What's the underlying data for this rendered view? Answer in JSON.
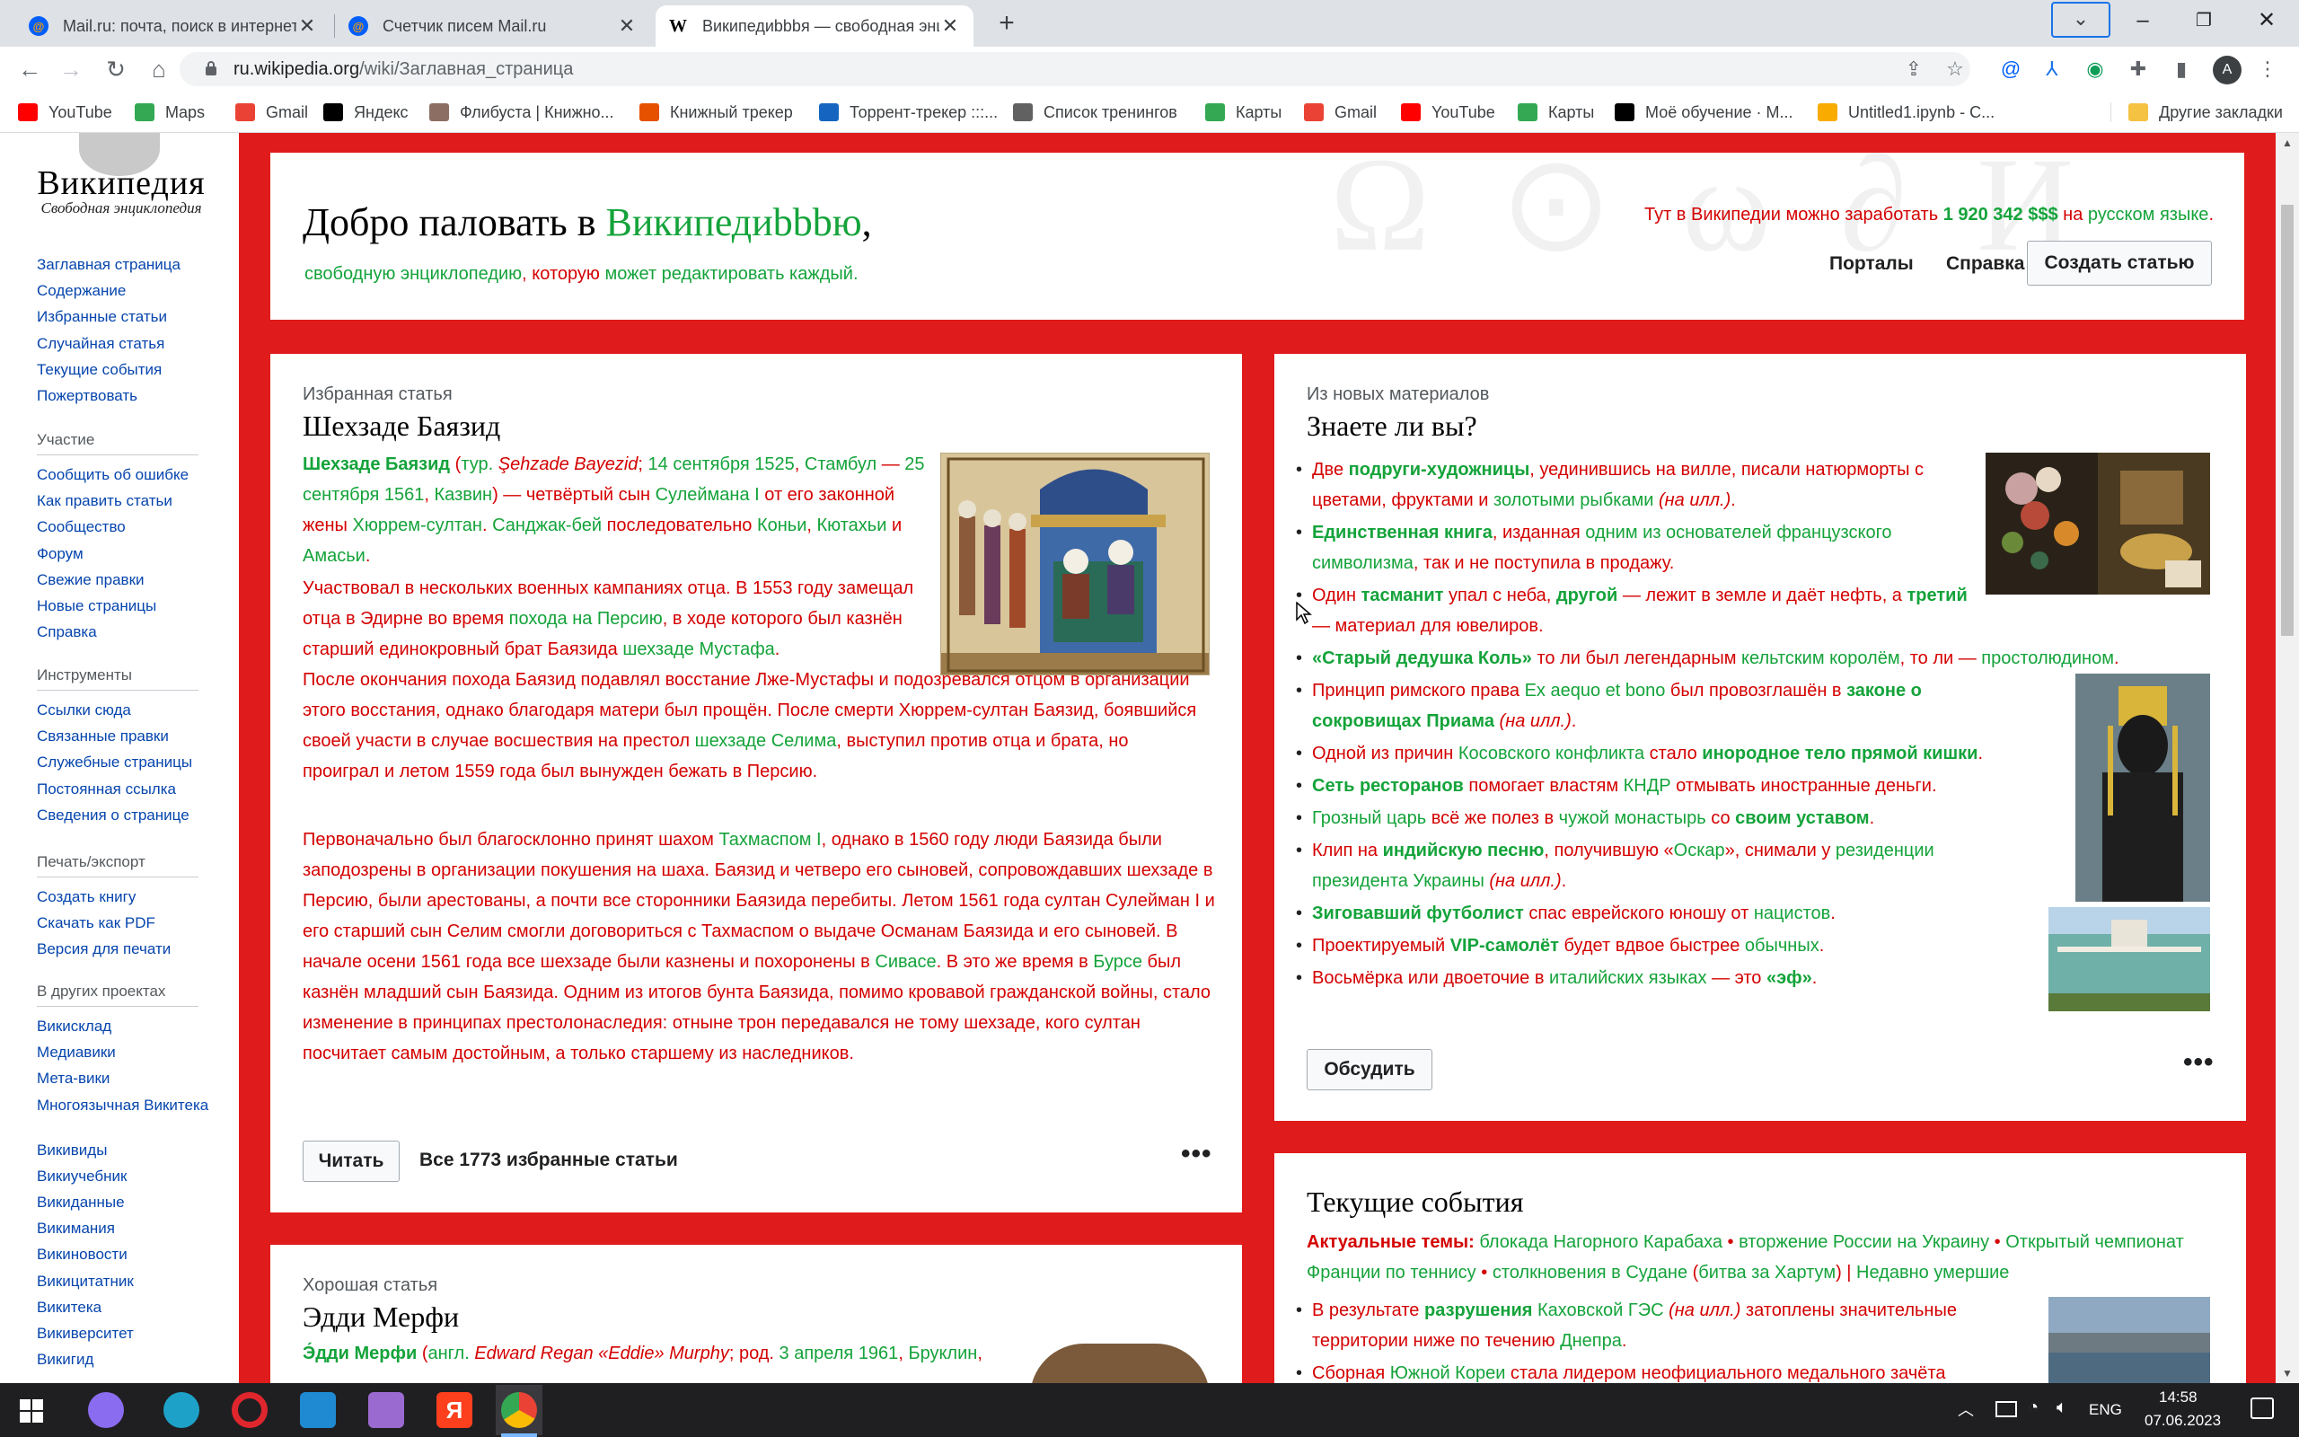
{
  "browser": {
    "tabs": [
      {
        "title": "Mail.ru: почта, поиск в интернете",
        "icon": "mailru-icon"
      },
      {
        "title": "Счетчик писем Mail.ru",
        "icon": "mailru-icon"
      },
      {
        "title": "Википедиbbbя — свободная энциклопедия",
        "icon": "wikipedia-icon"
      }
    ],
    "url_host": "ru.wikipedia.org",
    "url_path": "/wiki/Заглавная_страница",
    "profile_initial": "A",
    "bookmarks": [
      {
        "label": "YouTube",
        "color": "#ff0000"
      },
      {
        "label": "Maps",
        "color": "#34a853"
      },
      {
        "label": "Gmail",
        "color": "#ea4335"
      },
      {
        "label": "Яндекс",
        "color": "#000000"
      },
      {
        "label": "Флибуста | Книжно...",
        "color": "#8d6e63"
      },
      {
        "label": "Книжный трекер",
        "color": "#e65100"
      },
      {
        "label": "Торрент-трекер :::...",
        "color": "#1565c0"
      },
      {
        "label": "Список тренингов",
        "color": "#616161"
      },
      {
        "label": "Карты",
        "color": "#34a853"
      },
      {
        "label": "Gmail",
        "color": "#ea4335"
      },
      {
        "label": "YouTube",
        "color": "#ff0000"
      },
      {
        "label": "Карты",
        "color": "#34a853"
      },
      {
        "label": "Моё обучение · М...",
        "color": "#000000"
      },
      {
        "label": "Untitled1.ipynb - C...",
        "color": "#f9ab00"
      }
    ],
    "other_bookmarks": "Другие закладки"
  },
  "sidebar": {
    "logo_title": "Википедия",
    "logo_subtitle": "Свободная энциклопедия",
    "main_links": [
      "Заглавная страница",
      "Содержание",
      "Избранные статьи",
      "Случайная статья",
      "Текущие события",
      "Пожертвовать"
    ],
    "participation_head": "Участие",
    "participation_links": [
      "Сообщить об ошибке",
      "Как править статьи",
      "Сообщество",
      "Форум",
      "Свежие правки",
      "Новые страницы",
      "Справка"
    ],
    "tools_head": "Инструменты",
    "tools_links": [
      "Ссылки сюда",
      "Связанные правки",
      "Служебные страницы",
      "Постоянная ссылка",
      "Сведения о странице"
    ],
    "print_head": "Печать/экспорт",
    "print_links": [
      "Создать книгу",
      "Скачать как PDF",
      "Версия для печати"
    ],
    "projects_head": "В других проектах",
    "projects_links": [
      "Викисклад",
      "Медиавики",
      "Мета-вики",
      "Многоязычная Викитека",
      "Викивиды",
      "Викиучебник",
      "Викиданные",
      "Викимания",
      "Викиновости",
      "Викицитатник",
      "Викитека",
      "Викиверситет",
      "Викигид"
    ]
  },
  "welcome": {
    "title_prefix": "Добро паловать в ",
    "title_link": "Википедиbbbю",
    "title_suffix": ",",
    "sub_1": "свободную энциклопедию",
    "sub_2": ", которую ",
    "sub_3": "может редактировать каждый",
    "sub_4": ".",
    "earn_1": "Тут в Википедии можно заработать ",
    "earn_2": "1 920 342 $$$",
    "earn_3": " на ",
    "earn_4": "русском языке",
    "earn_5": ".",
    "portals": "Порталы",
    "help": "Справка",
    "create": "Создать статью"
  },
  "featured": {
    "label": "Избранная статья",
    "title": "Шехзаде Баязид",
    "read": "Читать",
    "all": "Все 1773 избранные статьи"
  },
  "good": {
    "label": "Хорошая статья",
    "title": "Эдди Мерфи"
  },
  "dyk": {
    "label": "Из новых материалов",
    "title": "Знаете ли вы?",
    "discuss": "Обсудить"
  },
  "events": {
    "title": "Текущие события",
    "topics_label": "Актуальные темы:"
  },
  "taskbar": {
    "lang": "ENG",
    "time": "14:58",
    "date": "07.06.2023"
  }
}
